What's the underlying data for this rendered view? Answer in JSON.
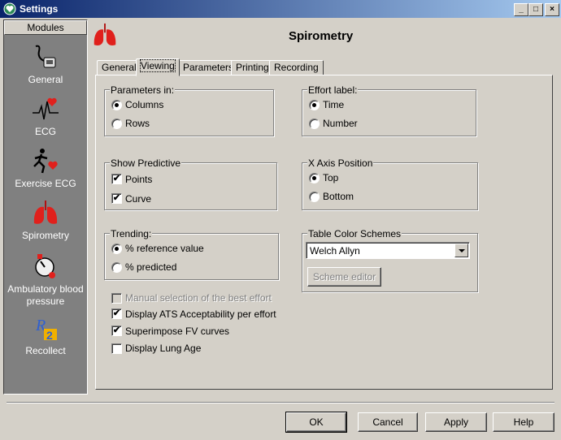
{
  "window": {
    "title": "Settings"
  },
  "sidebar": {
    "header": "Modules",
    "items": [
      {
        "label": "General"
      },
      {
        "label": "ECG"
      },
      {
        "label": "Exercise ECG"
      },
      {
        "label": "Spirometry"
      },
      {
        "label": "Ambulatory blood pressure"
      },
      {
        "label": "Recollect"
      }
    ]
  },
  "header": {
    "title": "Spirometry"
  },
  "tabs": [
    {
      "label": "General"
    },
    {
      "label": "Viewing",
      "active": true
    },
    {
      "label": "Parameters"
    },
    {
      "label": "Printing"
    },
    {
      "label": "Recording"
    }
  ],
  "parameters_in": {
    "title": "Parameters in:",
    "options": [
      "Columns",
      "Rows"
    ],
    "selected": "Columns"
  },
  "effort_label": {
    "title": "Effort label:",
    "options": [
      "Time",
      "Number"
    ],
    "selected": "Time"
  },
  "show_predictive": {
    "title": "Show Predictive",
    "options": [
      {
        "label": "Points",
        "checked": true
      },
      {
        "label": "Curve",
        "checked": true
      }
    ]
  },
  "x_axis_position": {
    "title": "X Axis Position",
    "options": [
      "Top",
      "Bottom"
    ],
    "selected": "Top"
  },
  "trending": {
    "title": "Trending:",
    "options": [
      "% reference value",
      "% predicted"
    ],
    "selected": "% reference value"
  },
  "table_color_schemes": {
    "title": "Table Color Schemes",
    "selected": "Welch Allyn",
    "editor_button": "Scheme editor"
  },
  "options": [
    {
      "label": "Manual selection of the best effort",
      "checked": false,
      "disabled": true
    },
    {
      "label": "Display ATS Acceptability per effort",
      "checked": true
    },
    {
      "label": "Superimpose FV curves",
      "checked": true
    },
    {
      "label": "Display Lung Age",
      "checked": false
    }
  ],
  "buttons": {
    "ok": "OK",
    "cancel": "Cancel",
    "apply": "Apply",
    "help": "Help"
  },
  "colors": {
    "titlebar": "#0a246a",
    "face": "#d4d0c8",
    "sidebar": "#808080",
    "lung_red": "#e0201c"
  }
}
